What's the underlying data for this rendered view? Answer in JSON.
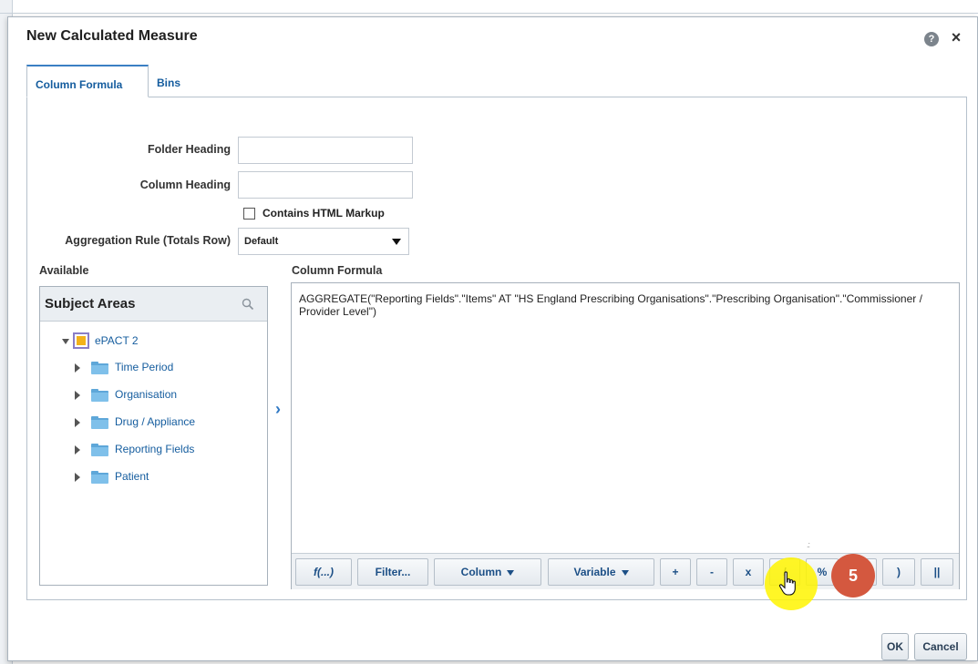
{
  "dialog": {
    "title": "New Calculated Measure",
    "help_icon": "help-icon",
    "help_glyph": "?",
    "close_icon": "close-icon",
    "close_glyph": "×"
  },
  "tabs": [
    {
      "label": "Column Formula",
      "active": true
    },
    {
      "label": "Bins",
      "active": false
    }
  ],
  "form": {
    "folder_heading_label": "Folder Heading",
    "folder_heading_value": "",
    "column_heading_label": "Column Heading",
    "column_heading_value": "",
    "contains_html_label": "Contains HTML Markup",
    "contains_html_checked": false,
    "aggregation_label": "Aggregation Rule (Totals Row)",
    "aggregation_value": "Default"
  },
  "available": {
    "label": "Available",
    "panel_title": "Subject Areas",
    "search_icon": "search-icon",
    "tree": {
      "root": {
        "label": "ePACT 2",
        "expanded": true,
        "icon": "subject-area-icon"
      },
      "children": [
        {
          "label": "Time Period",
          "icon": "folder-icon"
        },
        {
          "label": "Organisation",
          "icon": "folder-icon"
        },
        {
          "label": "Drug / Appliance",
          "icon": "folder-icon"
        },
        {
          "label": "Reporting Fields",
          "icon": "folder-icon"
        },
        {
          "label": "Patient",
          "icon": "folder-icon"
        }
      ]
    },
    "move_arrow_glyph": "›"
  },
  "formula": {
    "label": "Column Formula",
    "text": "AGGREGATE(\"Reporting Fields\".\"Items\" AT \"HS England Prescribing Organisations\".\"Prescribing Organisation\".\"Commissioner / Provider Level\")",
    "toolbar": [
      {
        "label": "f(...)",
        "name": "function-button",
        "italic": true
      },
      {
        "label": "Filter...",
        "name": "filter-button"
      },
      {
        "label": "Column",
        "name": "column-dropdown-button",
        "caret": true
      },
      {
        "label": "Variable",
        "name": "variable-dropdown-button",
        "caret": true
      },
      {
        "label": "+",
        "name": "plus-operator-button"
      },
      {
        "label": "-",
        "name": "minus-operator-button"
      },
      {
        "label": "x",
        "name": "multiply-operator-button"
      },
      {
        "label": "/",
        "name": "divide-operator-button"
      },
      {
        "label": "%",
        "name": "percent-operator-button"
      },
      {
        "label": "(",
        "name": "open-paren-button"
      },
      {
        "label": ")",
        "name": "close-paren-button"
      },
      {
        "label": "||",
        "name": "concat-operator-button"
      }
    ]
  },
  "annotation": {
    "step_number": "5",
    "cursor_icon": "pointer-hand-icon",
    "highlight_color": "#fff500",
    "badge_color": "#d4583f"
  },
  "footer": {
    "ok_label": "OK",
    "cancel_label": "Cancel"
  }
}
